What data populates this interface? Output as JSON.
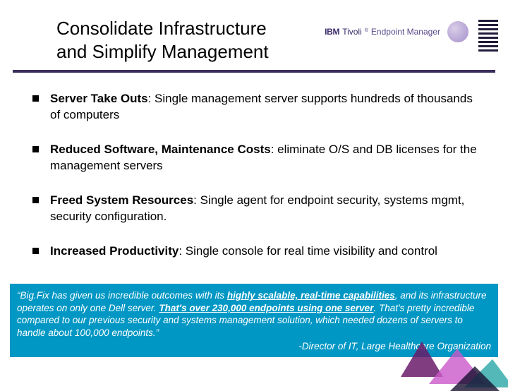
{
  "header": {
    "title_line1": "Consolidate Infrastructure",
    "title_line2": "and Simplify Management"
  },
  "brand": {
    "ibm": "IBM",
    "tivoli": "Tivoli",
    "reg": "®",
    "product": "Endpoint Manager"
  },
  "bullets": [
    {
      "bold": "Server Take Outs",
      "rest": ": Single management server supports hundreds of thousands of computers"
    },
    {
      "bold": "Reduced Software, Maintenance Costs",
      "rest": ": eliminate O/S and DB licenses for the management servers"
    },
    {
      "bold": "Freed System Resources",
      "rest": ": Single agent for endpoint security, systems mgmt, security configuration."
    },
    {
      "bold": "Increased Productivity",
      "rest": ": Single console for real time visibility and control"
    }
  ],
  "quote": {
    "p1a": "“Big.Fix has given us incredible outcomes with its ",
    "u1": "highly scalable, real-time capabilities",
    "p1b": ", and its infrastructure operates on only one Dell server. ",
    "u2": "That's over 230,000 endpoints using one server",
    "p1c": ". That's pretty incredible compared to our previous security and systems management solution, which needed dozens of servers to handle about 100,000 endpoints.”",
    "attribution": "-Director of IT, Large Healthcare Organization"
  }
}
